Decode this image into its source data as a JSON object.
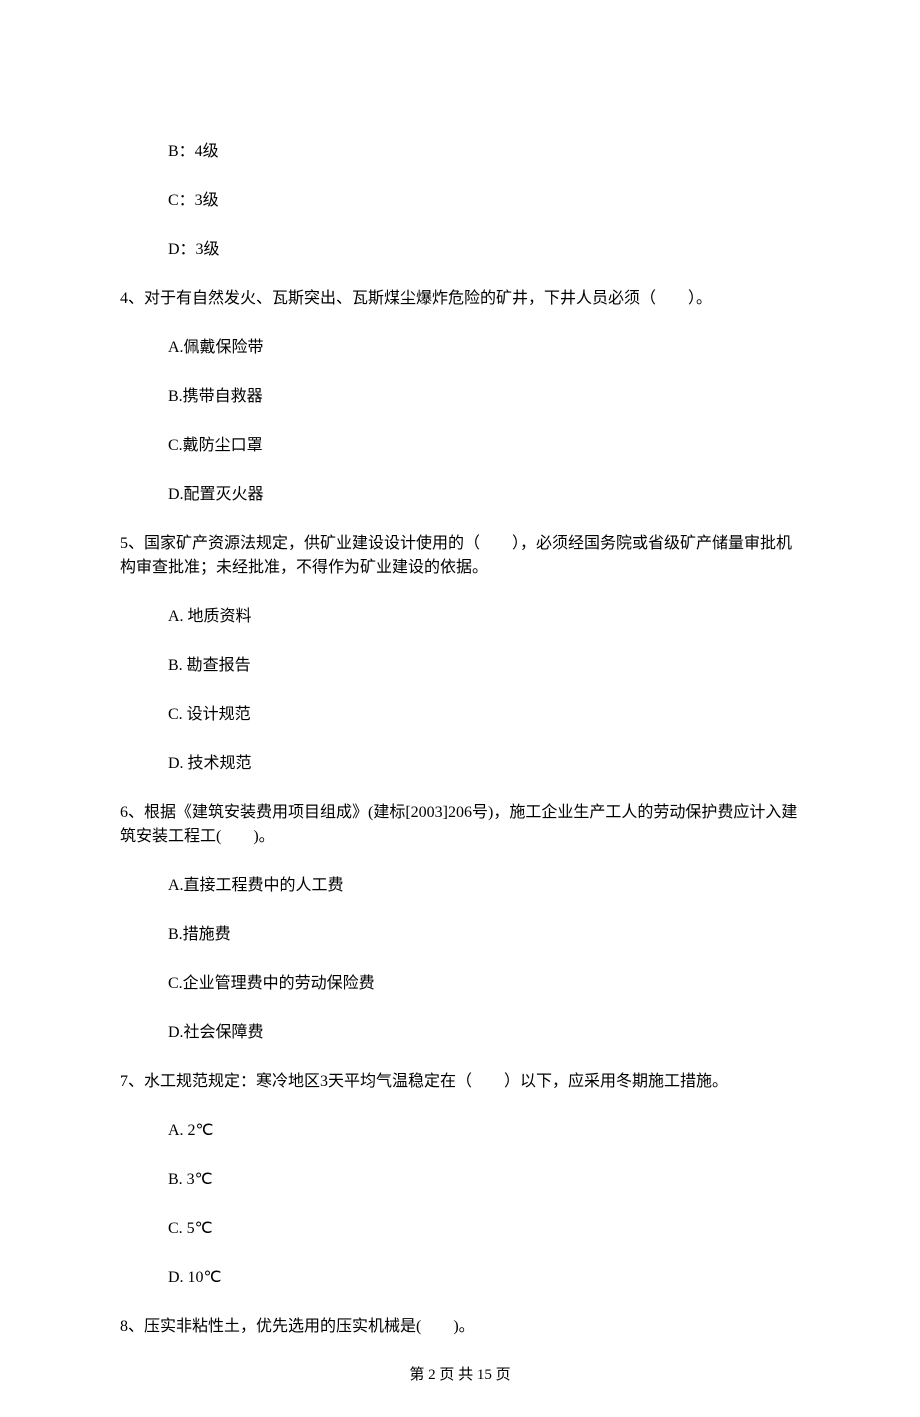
{
  "q3": {
    "b": "B：4级",
    "c": "C：3级",
    "d": "D：3级"
  },
  "q4": {
    "text": "4、对于有自然发火、瓦斯突出、瓦斯煤尘爆炸危险的矿井，下井人员必须（　　）。",
    "a": "A.佩戴保险带",
    "b": "B.携带自救器",
    "c": "C.戴防尘口罩",
    "d": "D.配置灭火器"
  },
  "q5": {
    "text": "5、国家矿产资源法规定，供矿业建设设计使用的（　　），必须经国务院或省级矿产储量审批机构审查批准；未经批准，不得作为矿业建设的依据。",
    "a": "A. 地质资料",
    "b": "B. 勘查报告",
    "c": "C. 设计规范",
    "d": "D. 技术规范"
  },
  "q6": {
    "text": "6、根据《建筑安装费用项目组成》(建标[2003]206号)，施工企业生产工人的劳动保护费应计入建筑安装工程工(　　)。",
    "a": "A.直接工程费中的人工费",
    "b": "B.措施费",
    "c": "C.企业管理费中的劳动保险费",
    "d": "D.社会保障费"
  },
  "q7": {
    "text": "7、水工规范规定：寒冷地区3天平均气温稳定在（　　）以下，应采用冬期施工措施。",
    "a": "A. 2℃",
    "b": "B. 3℃",
    "c": "C. 5℃",
    "d": "D. 10℃"
  },
  "q8": {
    "text": "8、压实非粘性土，优先选用的压实机械是(　　)。"
  },
  "footer": "第 2 页 共 15 页"
}
